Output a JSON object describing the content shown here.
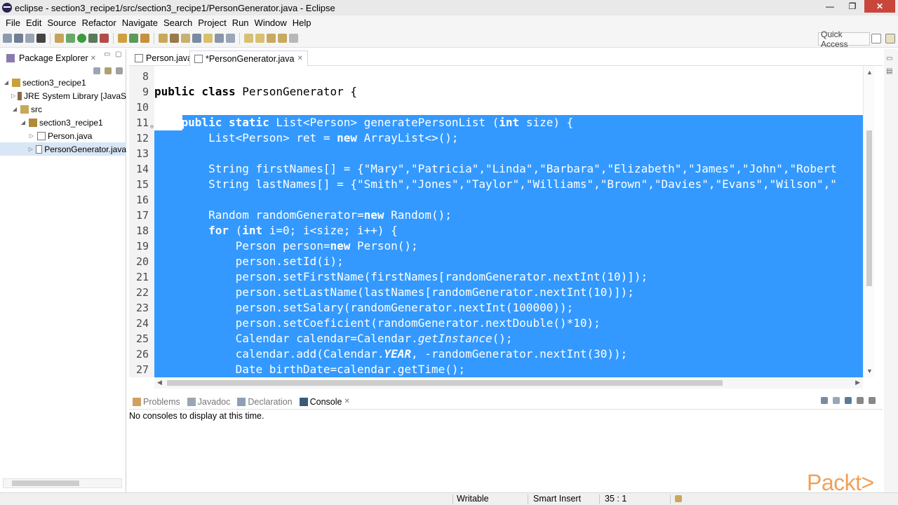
{
  "window": {
    "title": "eclipse - section3_recipe1/src/section3_recipe1/PersonGenerator.java - Eclipse",
    "min": "—",
    "max": "❐",
    "close": "✕"
  },
  "menu": [
    "File",
    "Edit",
    "Source",
    "Refactor",
    "Navigate",
    "Search",
    "Project",
    "Run",
    "Window",
    "Help"
  ],
  "toolbar": {
    "quick_access": "Quick Access"
  },
  "package_explorer": {
    "tab_label": "Package Explorer",
    "tree": [
      {
        "label": "section3_recipe1",
        "level": 0,
        "twisty": "◢",
        "icon": "project-icon"
      },
      {
        "label": "JRE System Library [JavaS",
        "level": 1,
        "twisty": "▷",
        "icon": "library-icon"
      },
      {
        "label": "src",
        "level": 1,
        "twisty": "◢",
        "icon": "source-folder-icon"
      },
      {
        "label": "section3_recipe1",
        "level": 2,
        "twisty": "◢",
        "icon": "package-icon"
      },
      {
        "label": "Person.java",
        "level": 3,
        "twisty": "▷",
        "icon": "java-file-icon"
      },
      {
        "label": "PersonGenerator.java",
        "level": 3,
        "twisty": "▷",
        "icon": "java-file-icon",
        "selected": true
      }
    ]
  },
  "editor": {
    "tabs": [
      {
        "label": "Person.java",
        "active": false
      },
      {
        "label": "*PersonGenerator.java",
        "active": true
      }
    ],
    "lines": [
      {
        "n": "8",
        "code": []
      },
      {
        "n": "9",
        "code": [
          {
            "t": "public class ",
            "k": true
          },
          {
            "t": "PersonGenerator {"
          }
        ]
      },
      {
        "n": "10",
        "code": []
      },
      {
        "n": "11",
        "sel": "partial",
        "code": [
          {
            "t": "    "
          },
          {
            "t": "public static ",
            "k": true
          },
          {
            "t": "List<Person> generatePersonList ("
          },
          {
            "t": "int",
            "k": true
          },
          {
            "t": " size) {"
          }
        ]
      },
      {
        "n": "12",
        "sel": "full",
        "code": [
          {
            "t": "        List<Person> ret = "
          },
          {
            "t": "new",
            "k": true
          },
          {
            "t": " ArrayList<>();"
          }
        ]
      },
      {
        "n": "13",
        "sel": "full",
        "code": []
      },
      {
        "n": "14",
        "sel": "full",
        "code": [
          {
            "t": "        String firstNames[] = {\"Mary\",\"Patricia\",\"Linda\",\"Barbara\",\"Elizabeth\",\"James\",\"John\",\"Robert"
          }
        ]
      },
      {
        "n": "15",
        "sel": "full",
        "code": [
          {
            "t": "        String lastNames[] = {\"Smith\",\"Jones\",\"Taylor\",\"Williams\",\"Brown\",\"Davies\",\"Evans\",\"Wilson\",\""
          }
        ]
      },
      {
        "n": "16",
        "sel": "full",
        "code": []
      },
      {
        "n": "17",
        "sel": "full",
        "code": [
          {
            "t": "        Random randomGenerator="
          },
          {
            "t": "new",
            "k": true
          },
          {
            "t": " Random();"
          }
        ]
      },
      {
        "n": "18",
        "sel": "full",
        "code": [
          {
            "t": "        "
          },
          {
            "t": "for",
            "k": true
          },
          {
            "t": " ("
          },
          {
            "t": "int",
            "k": true
          },
          {
            "t": " i=0; i<size; i++) {"
          }
        ]
      },
      {
        "n": "19",
        "sel": "full",
        "code": [
          {
            "t": "            Person person="
          },
          {
            "t": "new",
            "k": true
          },
          {
            "t": " Person();"
          }
        ]
      },
      {
        "n": "20",
        "sel": "full",
        "code": [
          {
            "t": "            person.setId(i);"
          }
        ]
      },
      {
        "n": "21",
        "sel": "full",
        "code": [
          {
            "t": "            person.setFirstName(firstNames[randomGenerator.nextInt(10)]);"
          }
        ]
      },
      {
        "n": "22",
        "sel": "full",
        "code": [
          {
            "t": "            person.setLastName(lastNames[randomGenerator.nextInt(10)]);"
          }
        ]
      },
      {
        "n": "23",
        "sel": "full",
        "code": [
          {
            "t": "            person.setSalary(randomGenerator.nextInt(100000));"
          }
        ]
      },
      {
        "n": "24",
        "sel": "full",
        "code": [
          {
            "t": "            person.setCoeficient(randomGenerator.nextDouble()*10);"
          }
        ]
      },
      {
        "n": "25",
        "sel": "full",
        "code": [
          {
            "t": "            Calendar calendar=Calendar."
          },
          {
            "t": "getInstance",
            "i": true
          },
          {
            "t": "();"
          }
        ]
      },
      {
        "n": "26",
        "sel": "full",
        "code": [
          {
            "t": "            calendar.add(Calendar."
          },
          {
            "t": "YEAR",
            "k": true,
            "i": true
          },
          {
            "t": ", -randomGenerator.nextInt(30));"
          }
        ]
      },
      {
        "n": "27",
        "sel": "full",
        "code": [
          {
            "t": "            Date birthDate=calendar.getTime();"
          }
        ]
      }
    ]
  },
  "console": {
    "tabs": [
      {
        "label": "Problems",
        "active": false,
        "icon": "problems-icon"
      },
      {
        "label": "Javadoc",
        "active": false,
        "icon": "javadoc-icon"
      },
      {
        "label": "Declaration",
        "active": false,
        "icon": "declaration-icon"
      },
      {
        "label": "Console",
        "active": true,
        "icon": "console-icon"
      }
    ],
    "message": "No consoles to display at this time."
  },
  "status": {
    "writable": "Writable",
    "insert_mode": "Smart Insert",
    "position": "35 : 1"
  },
  "watermark": "Packt>",
  "colors": {
    "selection": "#3399ff",
    "close_button": "#c9463d",
    "watermark": "#f0a05a"
  }
}
